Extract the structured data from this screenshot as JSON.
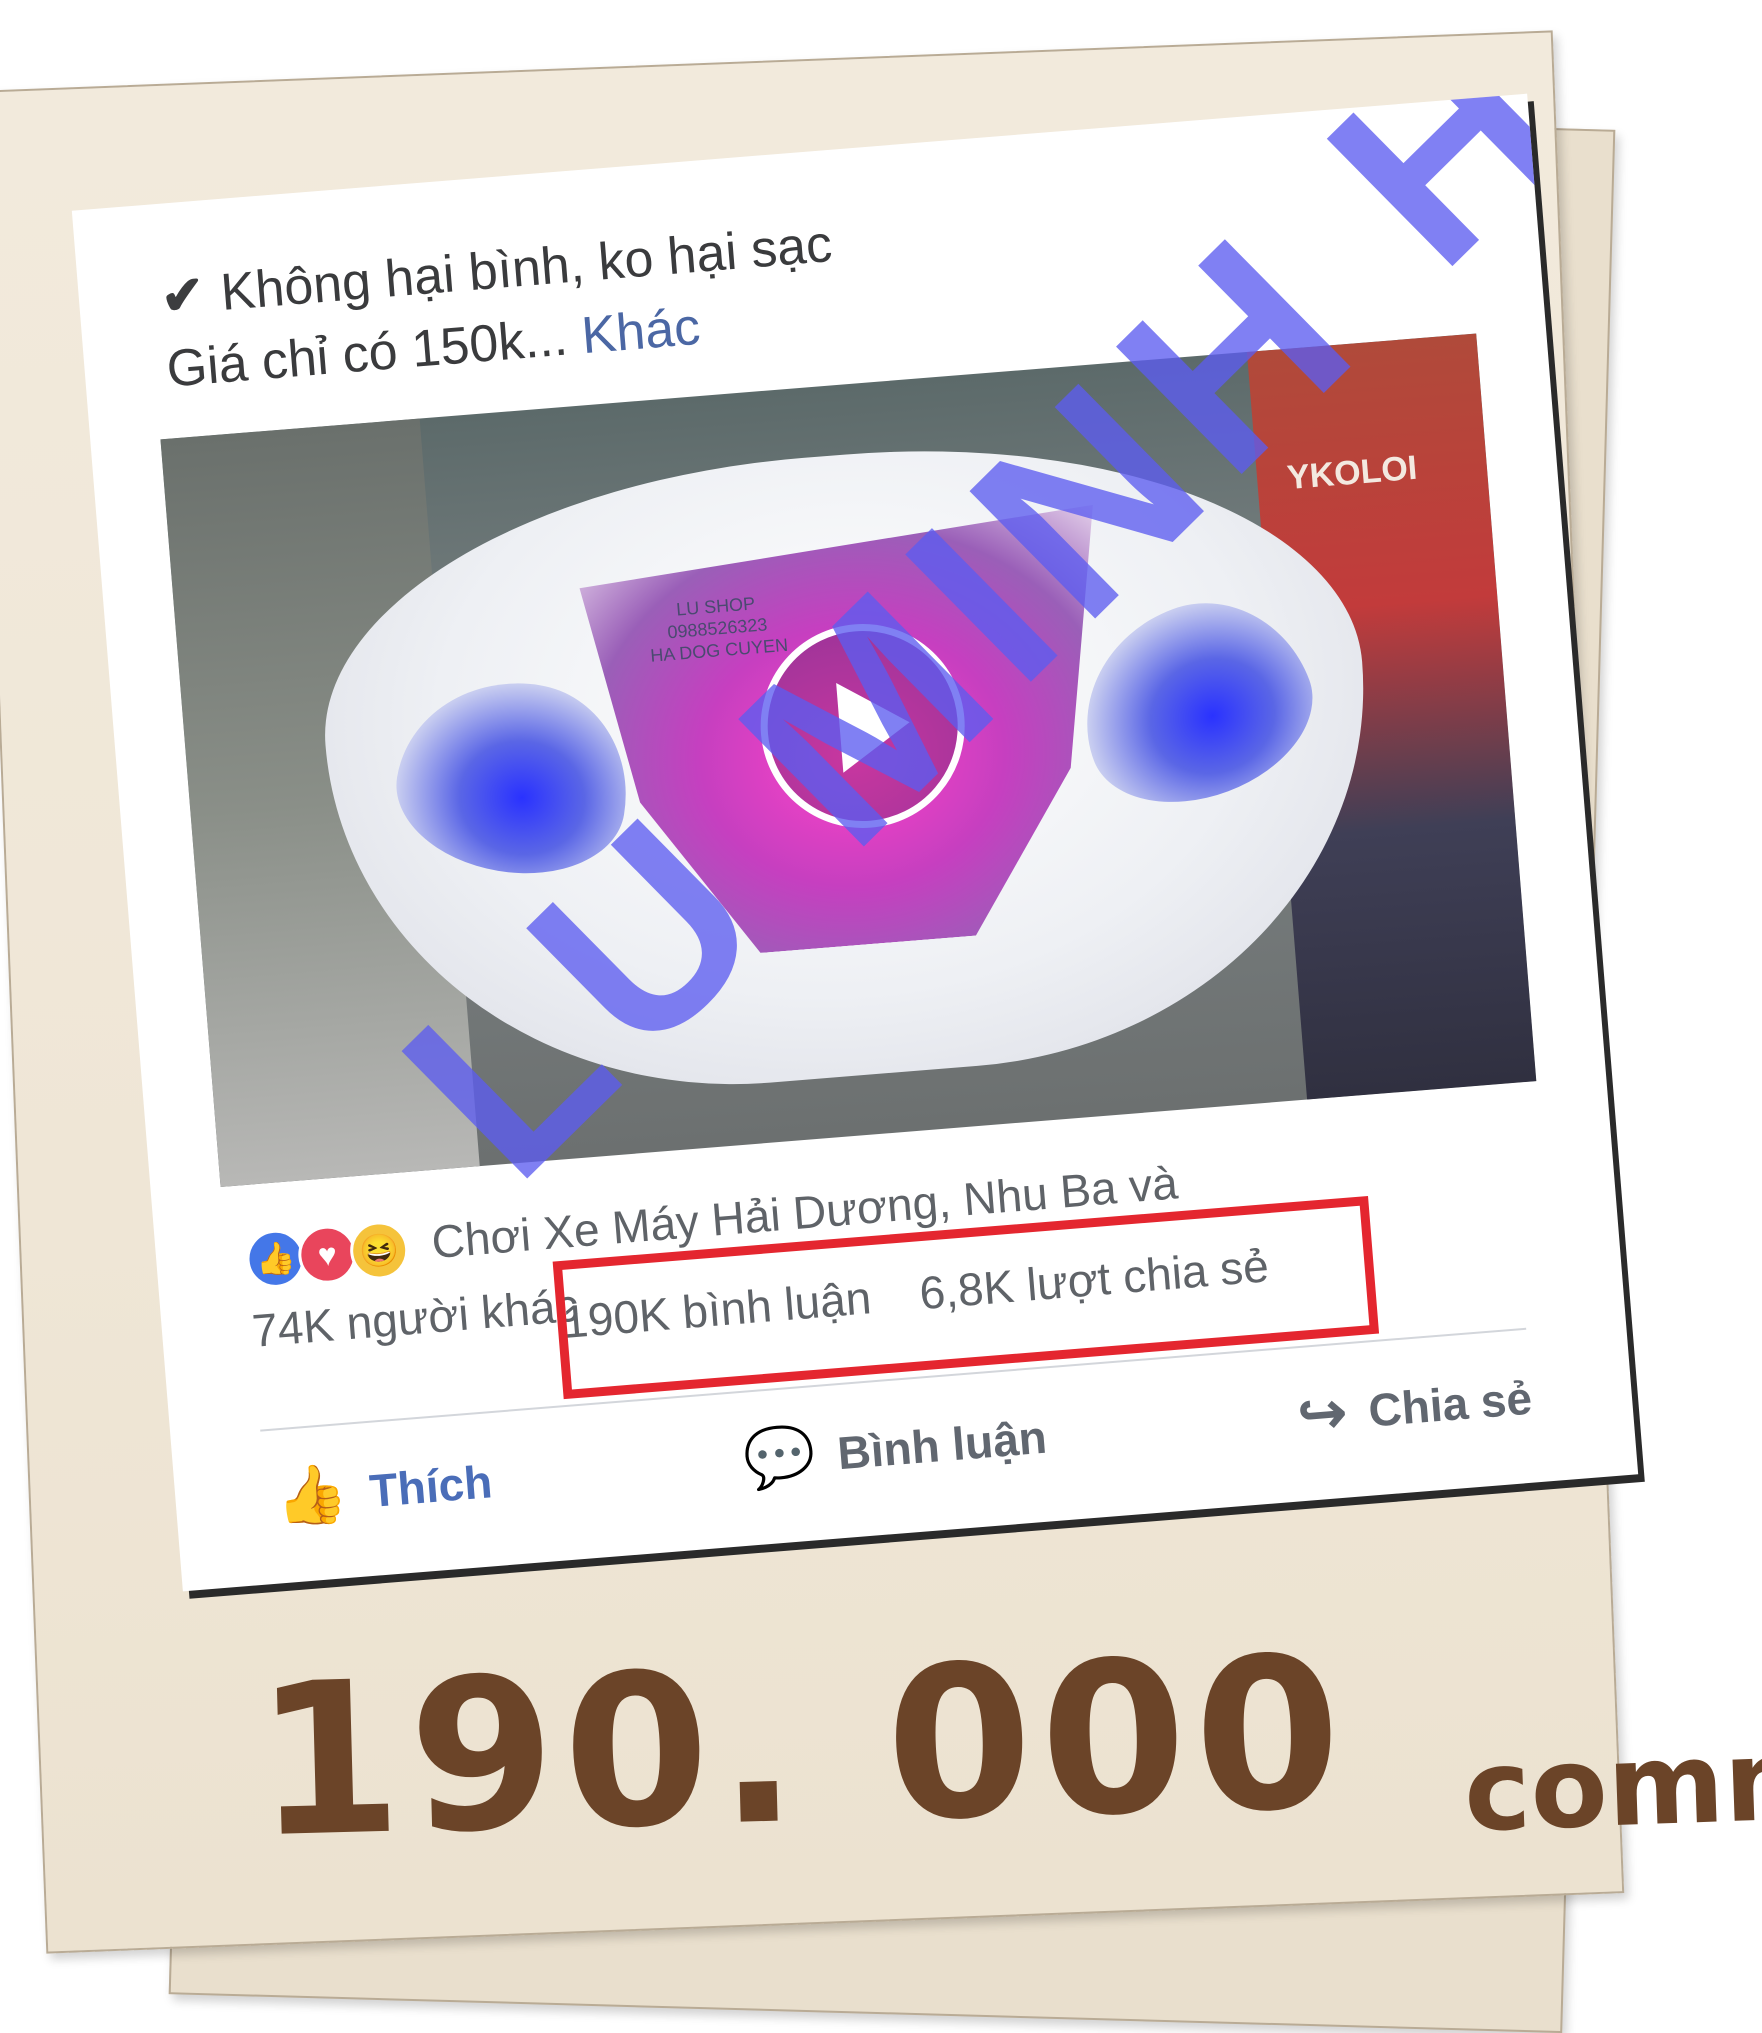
{
  "post": {
    "line1": "Không hại bình, ko hại sạc",
    "line2": "Giá chỉ có 150k...",
    "more_link": "Khác"
  },
  "video": {
    "shop_label_line1": "LU SHOP",
    "shop_label_line2": "0988526323",
    "shop_label_line3": "HA DOG CUYEN",
    "sign_text": "YKOLOI"
  },
  "reactions": {
    "text_line1": "Chơi Xe Máy Hải Dương, Nhu Ba và",
    "text_line2": "74K người khác",
    "comments": "190K bình luận",
    "shares": "6,8K lượt chia sẻ"
  },
  "actions": {
    "like": "Thích",
    "comment": "Bình luận",
    "share": "Chia sẻ"
  },
  "watermark": "LU MINH HẢ",
  "caption": {
    "number": "190. 000",
    "word": "comment"
  },
  "colors": {
    "highlight_box": "#e4262f",
    "link": "#4b67a4",
    "caption": "#6b4428",
    "watermark": "#5c5cf0"
  }
}
